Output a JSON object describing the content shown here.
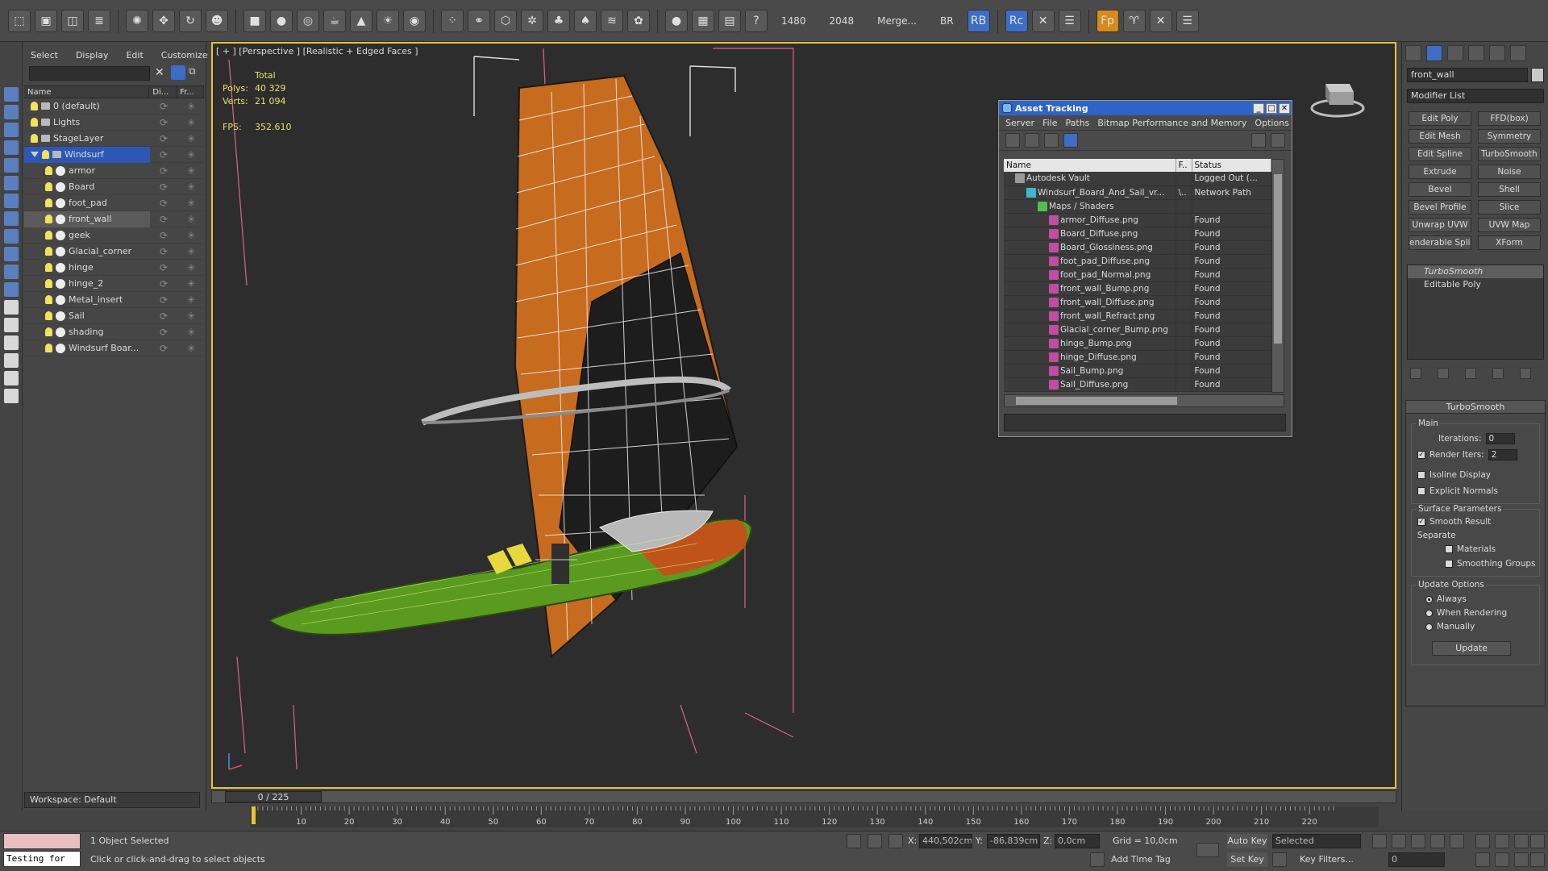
{
  "toolbar": {
    "num1": "1480",
    "num2": "2048",
    "merge": "Merge...",
    "br": "BR",
    "rb": "RB",
    "rc": "Rc",
    "fp": "Fp"
  },
  "scene_explorer": {
    "menu": [
      "Select",
      "Display",
      "Edit",
      "Customize"
    ],
    "columns": [
      "Name",
      "Di...",
      "Fr..."
    ],
    "rows": [
      {
        "label": "0 (default)",
        "type": "layer",
        "indent": 0,
        "state": ""
      },
      {
        "label": "Lights",
        "type": "layer",
        "indent": 0,
        "state": ""
      },
      {
        "label": "StageLayer",
        "type": "layer",
        "indent": 0,
        "state": ""
      },
      {
        "label": "Windsurf",
        "type": "layer",
        "indent": 0,
        "state": "selected"
      },
      {
        "label": "armor",
        "type": "object",
        "indent": 1,
        "state": ""
      },
      {
        "label": "Board",
        "type": "object",
        "indent": 1,
        "state": ""
      },
      {
        "label": "foot_pad",
        "type": "object",
        "indent": 1,
        "state": ""
      },
      {
        "label": "front_wall",
        "type": "object",
        "indent": 1,
        "state": "highlight"
      },
      {
        "label": "geek",
        "type": "object",
        "indent": 1,
        "state": ""
      },
      {
        "label": "Glacial_corner",
        "type": "object",
        "indent": 1,
        "state": ""
      },
      {
        "label": "hinge",
        "type": "object",
        "indent": 1,
        "state": ""
      },
      {
        "label": "hinge_2",
        "type": "object",
        "indent": 1,
        "state": ""
      },
      {
        "label": "Metal_insert",
        "type": "object",
        "indent": 1,
        "state": ""
      },
      {
        "label": "Sail",
        "type": "object",
        "indent": 1,
        "state": ""
      },
      {
        "label": "shading",
        "type": "object",
        "indent": 1,
        "state": ""
      },
      {
        "label": "Windsurf Boar...",
        "type": "object",
        "indent": 1,
        "state": ""
      }
    ],
    "workspace": "Workspace: Default"
  },
  "viewport": {
    "label": "[ + ] [Perspective ] [Realistic + Edged Faces ]",
    "stats": {
      "total_label": "Total",
      "polys_label": "Polys:",
      "polys": "40 329",
      "verts_label": "Verts:",
      "verts": "21 094",
      "fps_label": "FPS:",
      "fps": "352.610"
    },
    "time_slider": "0 / 225"
  },
  "asset_tracking": {
    "title": "Asset Tracking",
    "menu": [
      "Server",
      "File",
      "Paths",
      "Bitmap Performance and Memory",
      "Options"
    ],
    "columns": [
      "Name",
      "F..",
      "Status"
    ],
    "rows": [
      {
        "name": "Autodesk Vault",
        "f": "",
        "status": "Logged Out (...",
        "level": 0
      },
      {
        "name": "Windsurf_Board_And_Sail_vr...",
        "f": "\\..",
        "status": "Network Path",
        "level": 1
      },
      {
        "name": "Maps / Shaders",
        "f": "",
        "status": "",
        "level": 2
      },
      {
        "name": "armor_Diffuse.png",
        "f": "",
        "status": "Found",
        "level": 3
      },
      {
        "name": "Board_Diffuse.png",
        "f": "",
        "status": "Found",
        "level": 3
      },
      {
        "name": "Board_Glossiness.png",
        "f": "",
        "status": "Found",
        "level": 3
      },
      {
        "name": "foot_pad_Diffuse.png",
        "f": "",
        "status": "Found",
        "level": 3
      },
      {
        "name": "foot_pad_Normal.png",
        "f": "",
        "status": "Found",
        "level": 3
      },
      {
        "name": "front_wall_Bump.png",
        "f": "",
        "status": "Found",
        "level": 3
      },
      {
        "name": "front_wall_Diffuse.png",
        "f": "",
        "status": "Found",
        "level": 3
      },
      {
        "name": "front_wall_Refract.png",
        "f": "",
        "status": "Found",
        "level": 3
      },
      {
        "name": "Glacial_corner_Bump.png",
        "f": "",
        "status": "Found",
        "level": 3
      },
      {
        "name": "hinge_Bump.png",
        "f": "",
        "status": "Found",
        "level": 3
      },
      {
        "name": "hinge_Diffuse.png",
        "f": "",
        "status": "Found",
        "level": 3
      },
      {
        "name": "Sail_Bump.png",
        "f": "",
        "status": "Found",
        "level": 3
      },
      {
        "name": "Sail_Diffuse.png",
        "f": "",
        "status": "Found",
        "level": 3
      }
    ]
  },
  "command_panel": {
    "object_name": "front_wall",
    "modifier_list": "Modifier List",
    "modifier_buttons": [
      "Edit Poly",
      "FFD(box)",
      "Edit Mesh",
      "Symmetry",
      "Edit Spline",
      "TurboSmooth",
      "Extrude",
      "Noise",
      "Bevel",
      "Shell",
      "Bevel Profile",
      "Slice",
      "Unwrap UVW",
      "UVW Map",
      "enderable Splin",
      "XForm"
    ],
    "stack": [
      "TurboSmooth",
      "Editable Poly"
    ],
    "turbosmooth": {
      "title": "TurboSmooth",
      "main_label": "Main",
      "iterations_label": "Iterations:",
      "iterations": "0",
      "render_iters_label": "Render Iters:",
      "render_iters": "2",
      "isoline": "Isoline Display",
      "explicit_normals": "Explicit Normals",
      "surface_label": "Surface Parameters",
      "smooth_result": "Smooth Result",
      "separate_label": "Separate",
      "materials": "Materials",
      "smoothing_groups": "Smoothing Groups",
      "update_label": "Update Options",
      "always": "Always",
      "when_rendering": "When Rendering",
      "manually": "Manually",
      "update_button": "Update"
    }
  },
  "timeline": {
    "ticks": [
      10,
      20,
      30,
      40,
      50,
      60,
      70,
      80,
      90,
      100,
      110,
      120,
      130,
      140,
      150,
      160,
      170,
      180,
      190,
      200,
      210,
      220
    ],
    "max": 225
  },
  "status_bar": {
    "maxscript": "Testing for",
    "selection": "1 Object Selected",
    "prompt": "Click or click-and-drag to select objects",
    "x_label": "X:",
    "x": "440,502cm",
    "y_label": "Y:",
    "y": "-86,839cm",
    "z_label": "Z:",
    "z": "0,0cm",
    "grid": "Grid = 10,0cm",
    "add_time_tag": "Add Time Tag",
    "auto_key": "Auto Key",
    "set_key": "Set Key",
    "selected": "Selected",
    "key_filters": "Key Filters...",
    "frame": "0"
  }
}
